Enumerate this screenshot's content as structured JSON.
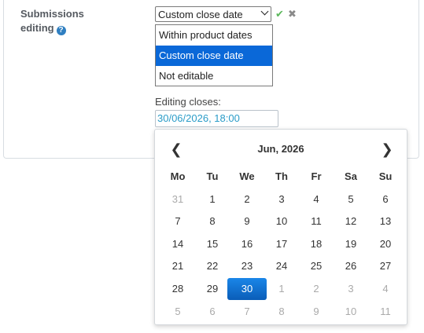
{
  "field": {
    "label_line1": "Submissions",
    "label_line2": "editing",
    "help_icon": "question-circle-icon"
  },
  "select": {
    "value": "Custom close date",
    "options": [
      "Within product dates",
      "Custom close date",
      "Not editable"
    ],
    "selected_index": 1
  },
  "actions": {
    "confirm_glyph": "✔",
    "cancel_glyph": "✖"
  },
  "editing": {
    "label": "Editing closes:",
    "value": "30/06/2026, 18:00"
  },
  "calendar": {
    "title": "Jun, 2026",
    "prev_glyph": "❮",
    "next_glyph": "❯",
    "weekdays": [
      "Mo",
      "Tu",
      "We",
      "Th",
      "Fr",
      "Sa",
      "Su"
    ],
    "weeks": [
      [
        "31",
        "1",
        "2",
        "3",
        "4",
        "5",
        "6"
      ],
      [
        "7",
        "8",
        "9",
        "10",
        "11",
        "12",
        "13"
      ],
      [
        "14",
        "15",
        "16",
        "17",
        "18",
        "19",
        "20"
      ],
      [
        "21",
        "22",
        "23",
        "24",
        "25",
        "26",
        "27"
      ],
      [
        "28",
        "29",
        "30",
        "1",
        "2",
        "3",
        "4"
      ],
      [
        "5",
        "6",
        "7",
        "8",
        "9",
        "10",
        "11"
      ]
    ],
    "selected_day": "30",
    "accent_color": "#0f6fd0"
  }
}
